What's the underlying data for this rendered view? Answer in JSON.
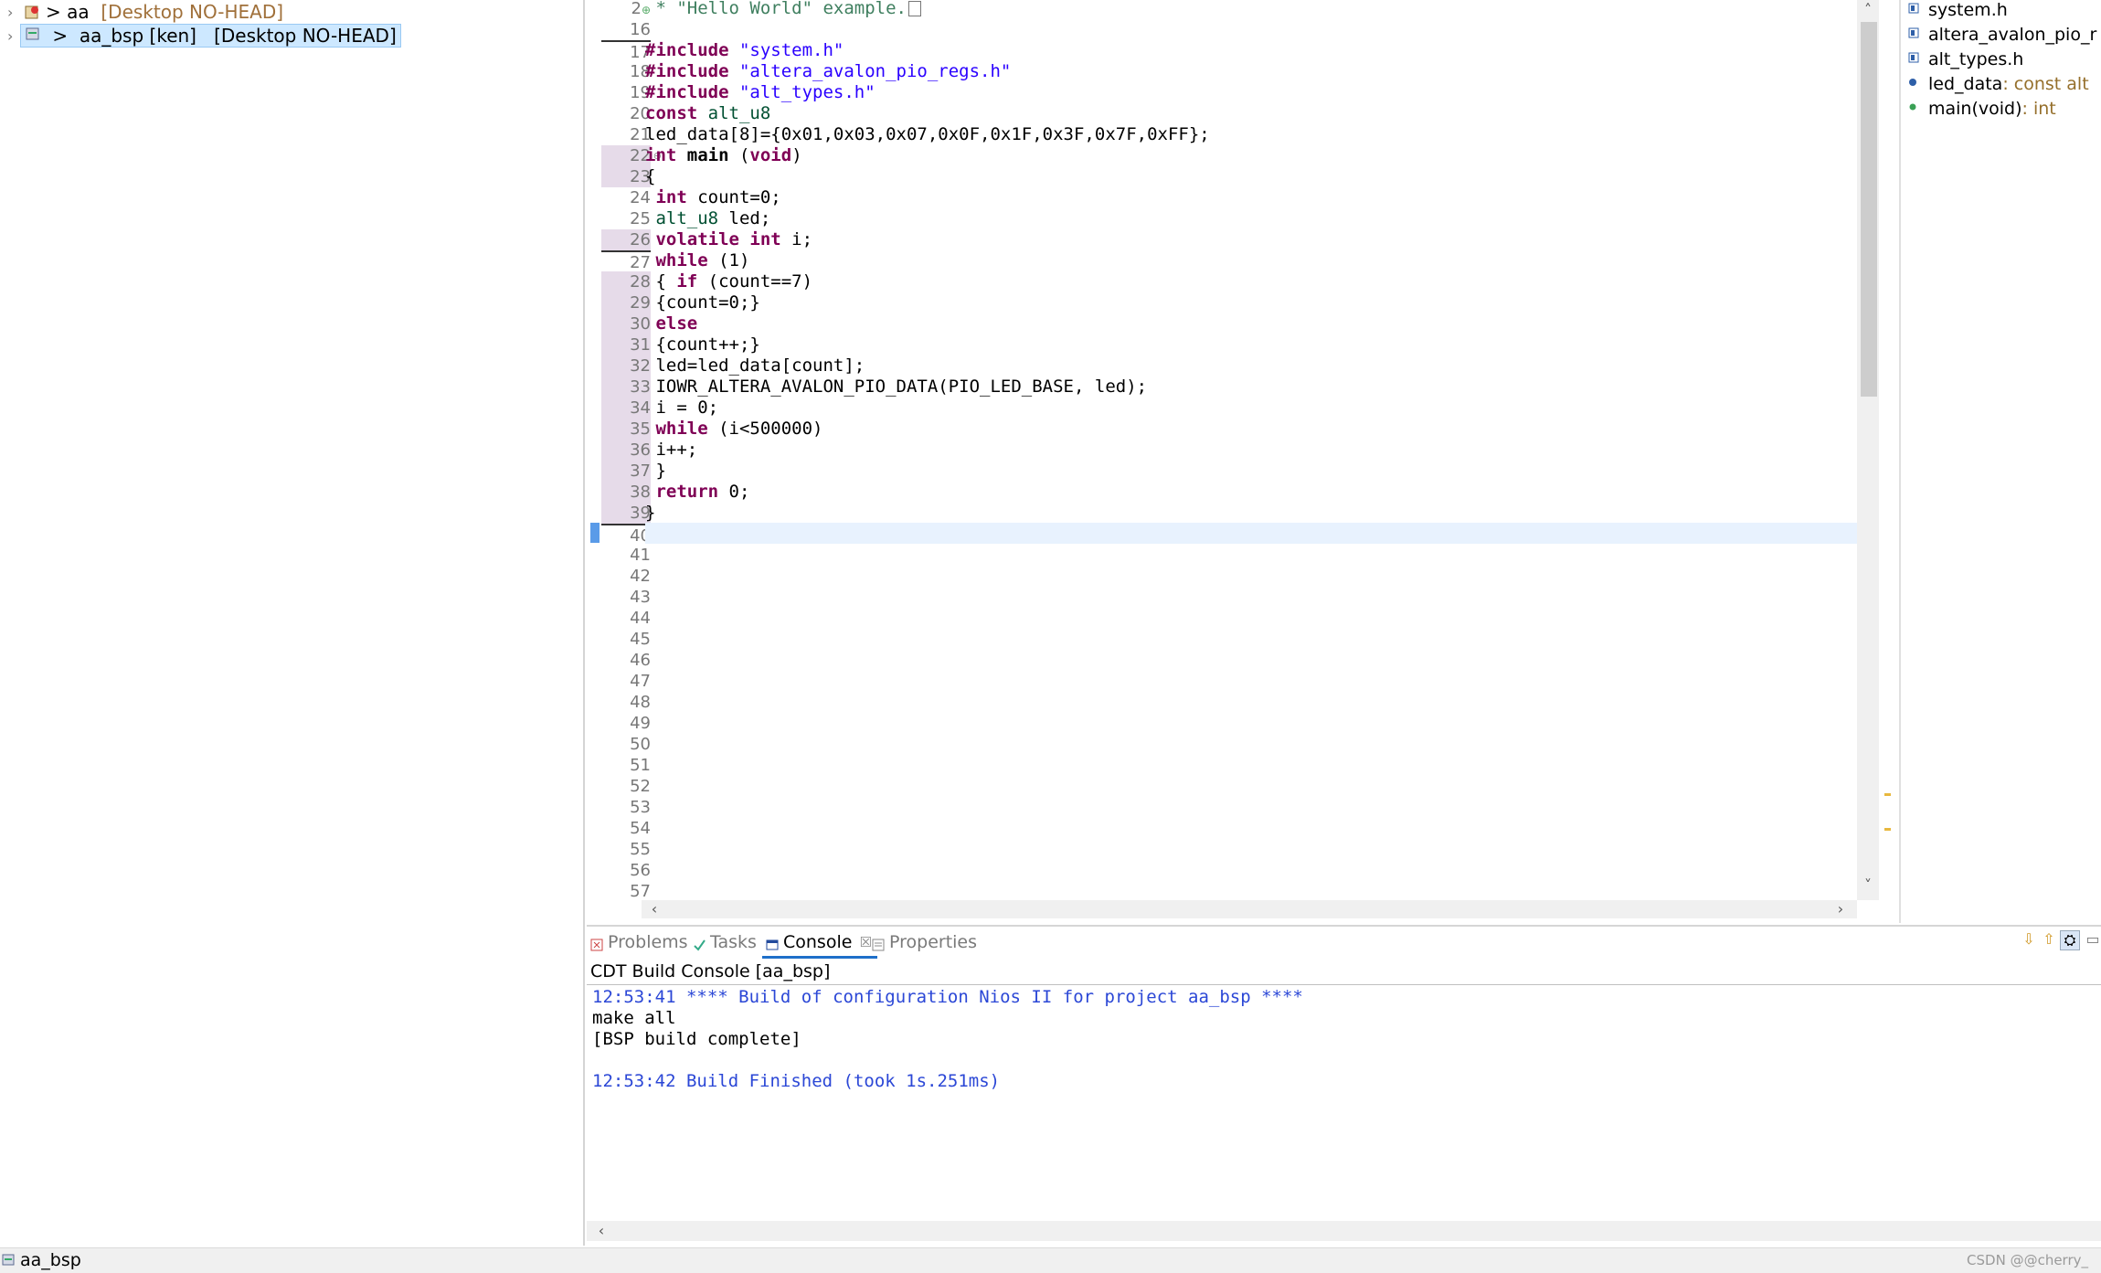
{
  "explorer": {
    "projects": [
      {
        "name": "aa",
        "git": "[Desktop NO-HEAD]",
        "selected": false
      },
      {
        "name": "aa_bsp [ken]",
        "git": "[Desktop NO-HEAD]",
        "selected": true
      }
    ]
  },
  "editor": {
    "first_line_num": "2",
    "first_line_text": " * \"Hello World\" example.",
    "line_numbers": [
      "16",
      "17",
      "18",
      "19",
      "20",
      "21",
      "22",
      "23",
      "24",
      "25",
      "26",
      "27",
      "28",
      "29",
      "30",
      "31",
      "32",
      "33",
      "34",
      "35",
      "36",
      "37",
      "38",
      "39",
      "40",
      "41",
      "42",
      "43",
      "44",
      "45",
      "46",
      "47",
      "48",
      "49",
      "50",
      "51",
      "52",
      "53",
      "54",
      "55",
      "56",
      "57"
    ],
    "code": {
      "l17_kw": "#include",
      "l17_str": " \"system.h\"",
      "l18_kw": "#include",
      "l18_str": " \"altera_avalon_pio_regs.h\"",
      "l19_kw": "#include",
      "l19_str": " \"alt_types.h\"",
      "l20_kw": "const",
      "l20_typ": " alt_u8",
      "l21": "led_data[8]={0x01,0x03,0x07,0x0F,0x1F,0x3F,0x7F,0xFF};",
      "l22_kw1": "int",
      "l22_fn": " main",
      "l22_rest1": " (",
      "l22_kw2": "void",
      "l22_rest2": ")",
      "l23": "{",
      "l24_kw": " int",
      "l24_rest": " count=0;",
      "l25_typ": " alt_u8",
      "l25_rest": " led;",
      "l26_kw1": " volatile",
      "l26_kw2": " int",
      "l26_rest": " i;",
      "l27_kw": " while",
      "l27_rest": " (1)",
      "l28_pre": " { ",
      "l28_kw": "if",
      "l28_rest": " (count==7)",
      "l29": " {count=0;}",
      "l30_kw": " else",
      "l31": " {count++;}",
      "l32": " led=led_data[count];",
      "l33": " IOWR_ALTERA_AVALON_PIO_DATA(PIO_LED_BASE, led);",
      "l34": " i = 0;",
      "l35_kw": " while",
      "l35_rest": " (i<500000)",
      "l36": " i++;",
      "l37": " }",
      "l38_kw": " return",
      "l38_rest": " 0;",
      "l39": "}"
    }
  },
  "outline": {
    "items": [
      {
        "name": "system.h",
        "type": ""
      },
      {
        "name": "altera_avalon_pio_r",
        "type": ""
      },
      {
        "name": "alt_types.h",
        "type": ""
      },
      {
        "name": "led_data",
        "type": " : const alt"
      },
      {
        "name": "main(void)",
        "type": " : int"
      }
    ]
  },
  "panel": {
    "tabs": [
      "Problems",
      "Tasks",
      "Console",
      "Properties"
    ],
    "console_title": "CDT Build Console [aa_bsp]",
    "lines": [
      "12:53:41 **** Build of configuration Nios II for project aa_bsp ****",
      "make all",
      "[BSP build complete]",
      "",
      "12:53:42 Build Finished (took 1s.251ms)"
    ]
  },
  "status": {
    "selection": "aa_bsp",
    "watermark": "CSDN @@cherry_"
  },
  "colors": {
    "keyword": "#7f0055",
    "string": "#2a00ff",
    "console_info": "#2b47d6",
    "selection_bg": "#cde8ff",
    "current_line": "#e8f2fe"
  }
}
